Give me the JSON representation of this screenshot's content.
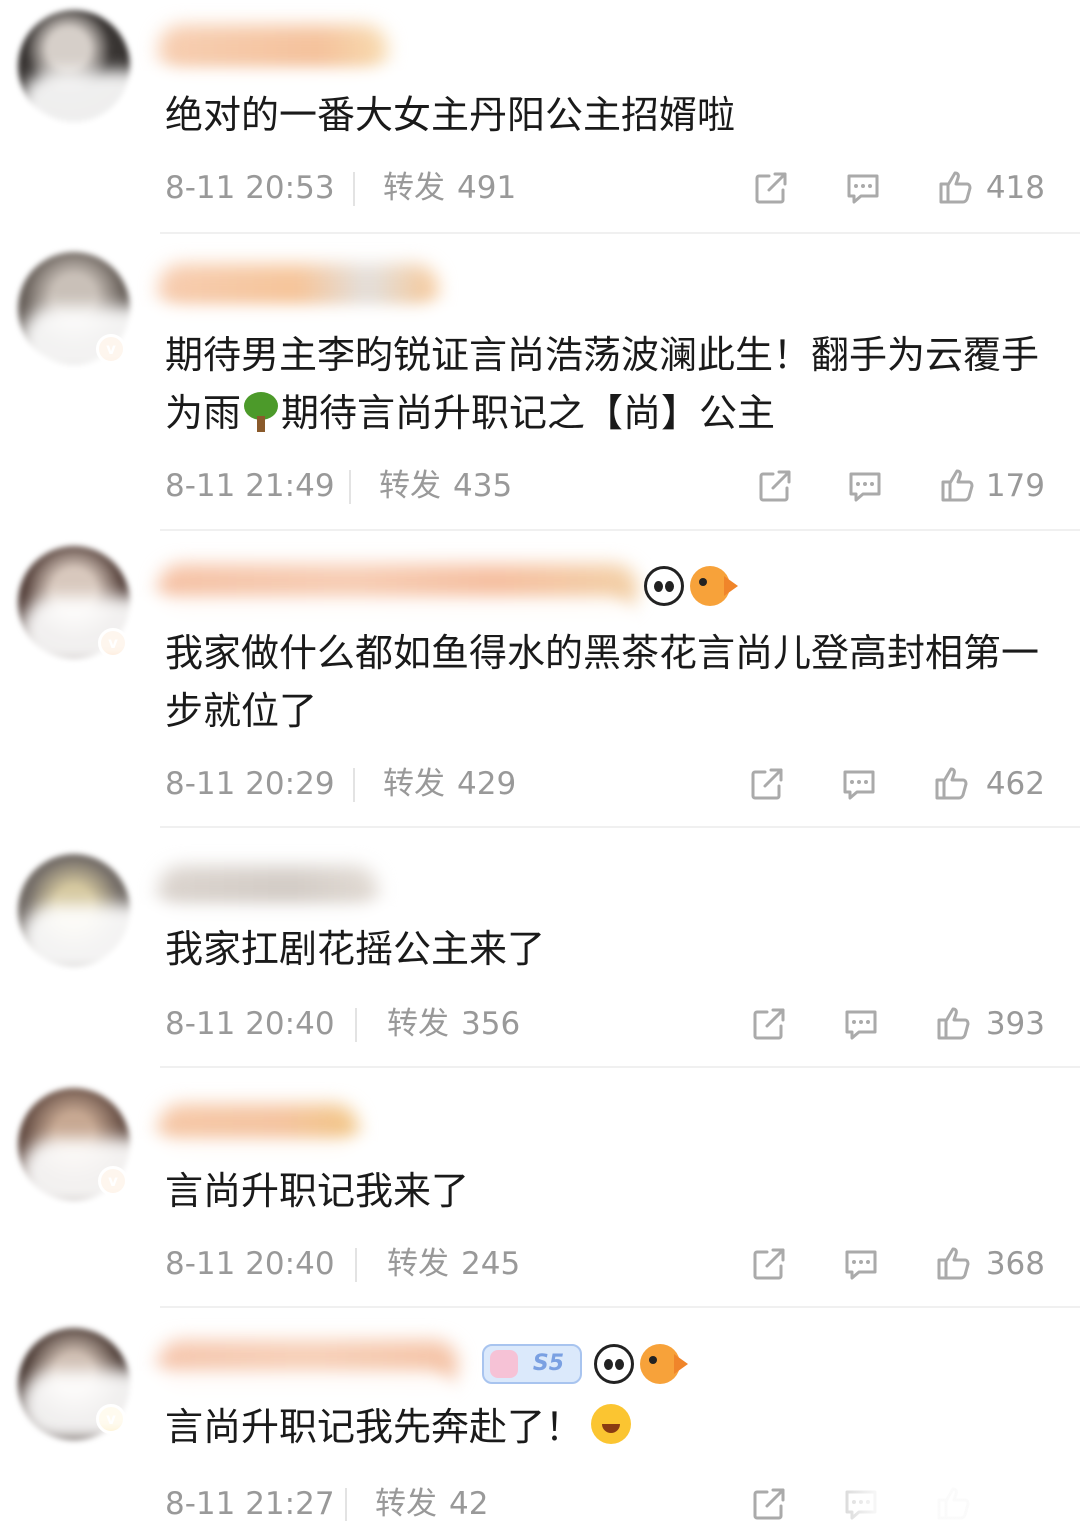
{
  "comments": [
    {
      "text": "绝对的一番大女主丹阳公主招婿啦",
      "time": "8-11 20:53",
      "repost_label": "转发",
      "repost_count": "491",
      "likes": "418",
      "avatar_color": "#3a3634",
      "name_blur_color": "#f5c9a8",
      "badge": "none"
    },
    {
      "text": "期待男主李昀锐证言尚浩荡波澜此生！翻手为云覆手为雨",
      "text_tail": "期待言尚升职记之【尚】公主",
      "time": "8-11 21:49",
      "repost_label": "转发",
      "repost_count": "435",
      "likes": "179",
      "avatar_color": "#6d655f",
      "name_blur_color": "#f6c59a",
      "badge": "orange"
    },
    {
      "text": "我家做什么都如鱼得水的黑茶花言尚儿登高封相第一步就位了",
      "time": "8-11 20:29",
      "repost_label": "转发",
      "repost_count": "429",
      "likes": "462",
      "avatar_color": "#5a4640",
      "name_blur_color": "#f6c2a5",
      "badge": "orange"
    },
    {
      "text": "我家扛剧花摇公主来了",
      "time": "8-11 20:40",
      "repost_label": "转发",
      "repost_count": "356",
      "likes": "393",
      "avatar_color": "#77706a",
      "name_blur_color": "#d9d2cc",
      "badge": "none"
    },
    {
      "text": "言尚升职记我来了",
      "time": "8-11 20:40",
      "repost_label": "转发",
      "repost_count": "245",
      "likes": "368",
      "avatar_color": "#6b5349",
      "name_blur_color": "#f4c4a0",
      "badge": "orange"
    },
    {
      "text": "言尚升职记我先奔赴了！",
      "time": "8-11 21:27",
      "repost_label": "转发",
      "repost_count": "42",
      "likes": "",
      "avatar_color": "#4f3f39",
      "name_blur_color": "#f6c6ad",
      "badge": "yellow",
      "member_badge": "S5"
    }
  ],
  "icons": {
    "share": "share-icon",
    "comment": "comment-icon",
    "like": "thumbs-up-icon"
  },
  "colors": {
    "meta_text": "#999999",
    "body_text": "#1a1a1a",
    "verified_badge": "#f28b2c"
  }
}
